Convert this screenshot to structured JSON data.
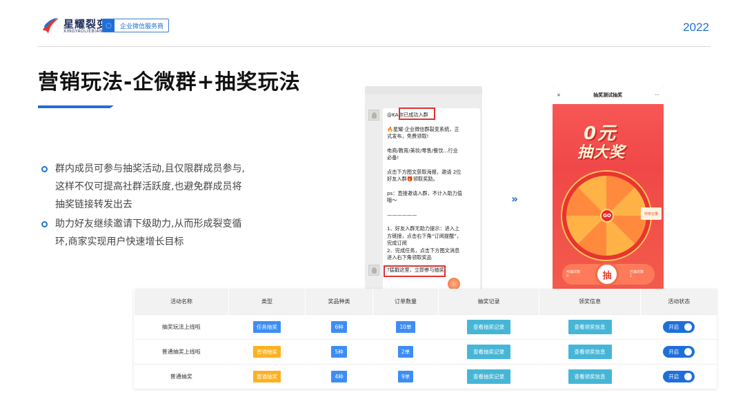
{
  "header": {
    "logo_title": "星耀裂变",
    "logo_sub": "XINGYAOLIEBIAN",
    "badge": "企业微信服务商",
    "year": "2022"
  },
  "title": "营销玩法-企微群+抽奖玩法",
  "bullets": [
    {
      "lines": [
        "群内成员可参与抽奖活动,且仅限群成员参与,",
        "这样不仅可提高社群活跃度,也避免群成员将",
        "抽奖链接转发出去"
      ]
    },
    {
      "lines": [
        "助力好友继续邀请下级助力,从而形成裂变循",
        "环,商家实现用户快速增长目标"
      ]
    }
  ],
  "chat": {
    "mention": "@KA",
    "success": "你已成功入群",
    "paragraphs": [
      "🔥星耀·企业微信群裂变系统，正",
      "式发布，免费领取!",
      "电商/教育/美妆/零售/餐饮...行业",
      "必备!",
      "点击下方图文获取海报，邀请 2位",
      "好友入群🎁领取奖励。",
      "ps：直接邀请入群，不计入助力值",
      "哦～",
      "——————",
      "1、好友入群无助力提示：进入上",
      "方链接，点击右下角“订阅提醒”，",
      "完成订阅",
      "2、完成任务，点击下方图文消息",
      "进入右下角领取奖品"
    ],
    "second_msg": "?猛戳这里，立即参与抽奖"
  },
  "phone": {
    "close": "×",
    "title": "抽奖测试抽奖",
    "more": "···",
    "big_line1": "0元",
    "big_line2": "抽大奖",
    "go": "GO",
    "gift": "中奖记录",
    "left_label": "可抽次数",
    "left_val": "0",
    "right_label": "已抽次数",
    "right_val": "1",
    "draw": "抽"
  },
  "table": {
    "headers": [
      "活动名称",
      "类型",
      "奖品种类",
      "订单数量",
      "抽奖记录",
      "领奖信息",
      "活动状态"
    ],
    "rows": [
      {
        "name": "抽奖玩法上线啦",
        "type": "任务抽奖",
        "type_color": "blue",
        "kinds": "6种",
        "orders": "10单",
        "record": "查看抽奖记录",
        "claim": "查看领奖信息",
        "status": "开启"
      },
      {
        "name": "普通抽奖上线啦",
        "type": "普通抽奖",
        "type_color": "orange",
        "kinds": "5种",
        "orders": "2单",
        "record": "查看抽奖记录",
        "claim": "查看领奖信息",
        "status": "开启"
      },
      {
        "name": "普通抽奖",
        "type": "普通抽奖",
        "type_color": "orange",
        "kinds": "4种",
        "orders": "9单",
        "record": "查看抽奖记录",
        "claim": "查看领奖信息",
        "status": "开启"
      }
    ]
  },
  "colors": {
    "accent": "#1f6fd1",
    "tag_blue": "#3d8df5",
    "tag_orange": "#ffb020",
    "button_teal": "#47b6d6",
    "highlight_red": "#e03030"
  }
}
